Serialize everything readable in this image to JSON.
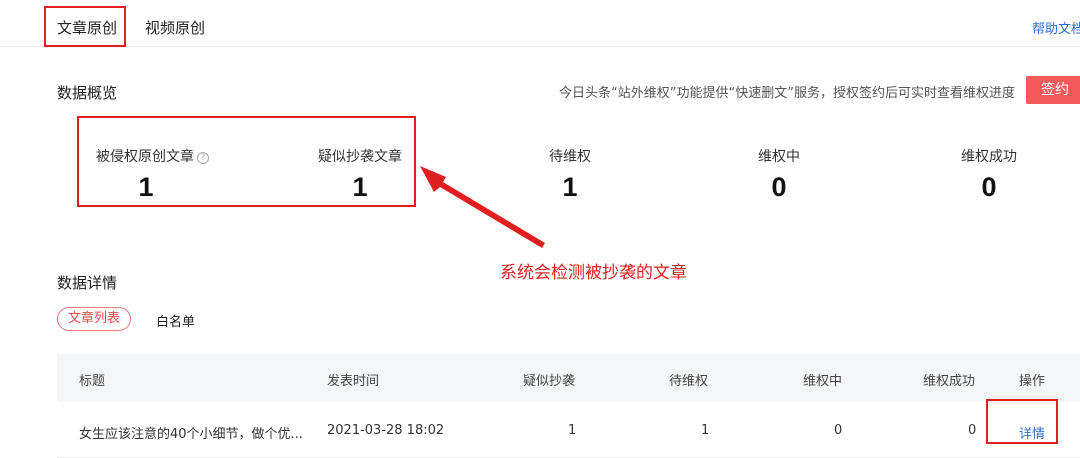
{
  "tabs": {
    "article": "文章原创",
    "video": "视频原创",
    "help": "帮助文档"
  },
  "overview": {
    "title": "数据概览",
    "notice": "今日头条“站外维权”功能提供“快速删文”服务，授权签约后可实时查看维权进度",
    "sign_button": "签约",
    "stats": [
      {
        "label": "被侵权原创文章",
        "value": "1"
      },
      {
        "label": "疑似抄袭文章",
        "value": "1"
      },
      {
        "label": "待维权",
        "value": "1"
      },
      {
        "label": "维权中",
        "value": "0"
      },
      {
        "label": "维权成功",
        "value": "0"
      }
    ],
    "help_glyph": "?"
  },
  "annotation": {
    "text": "系统会检测被抄袭的文章",
    "color": "#e02020"
  },
  "detail": {
    "title": "数据详情",
    "sub_tabs": {
      "active": "文章列表",
      "other": "白名单"
    },
    "columns": [
      "标题",
      "发表时间",
      "疑似抄袭",
      "待维权",
      "维权中",
      "维权成功",
      "操作"
    ],
    "rows": [
      {
        "title": "女生应该注意的40个小细节，做个优...",
        "time": "2021-03-28 18:02",
        "suspected": "1",
        "pending": "1",
        "in_progress": "0",
        "success": "0",
        "action": "详情"
      }
    ]
  },
  "colors": {
    "accent": "#f55a5a",
    "link": "#2f6fd6",
    "annotation": "#e02020"
  }
}
